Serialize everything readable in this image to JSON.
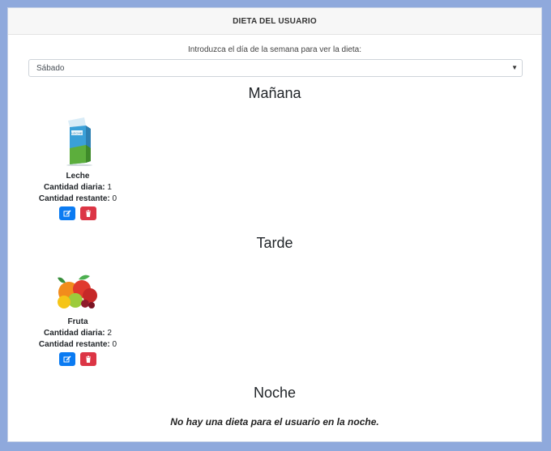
{
  "header": {
    "title": "DIETA DEL USUARIO"
  },
  "day_selector": {
    "prompt": "Introduzca el día de la semana para ver la dieta:",
    "selected": "Sábado"
  },
  "sections": {
    "morning": {
      "title": "Mañana",
      "item": {
        "name": "Leche",
        "daily_label": "Cantidad diaria:",
        "daily_value": "1",
        "remaining_label": "Cantidad restante:",
        "remaining_value": "0",
        "image_label": "LECHE"
      }
    },
    "afternoon": {
      "title": "Tarde",
      "item": {
        "name": "Fruta",
        "daily_label": "Cantidad diaria:",
        "daily_value": "2",
        "remaining_label": "Cantidad restante:",
        "remaining_value": "0"
      }
    },
    "night": {
      "title": "Noche",
      "empty_message": "No hay una dieta para el usuario en la noche."
    }
  },
  "icons": {
    "edit": "edit-icon",
    "delete": "trash-icon",
    "dropdown": "chevron-down-icon"
  },
  "colors": {
    "edit_button": "#0b7bf2",
    "delete_button": "#dc3545",
    "page_background": "#8fa9dc"
  }
}
